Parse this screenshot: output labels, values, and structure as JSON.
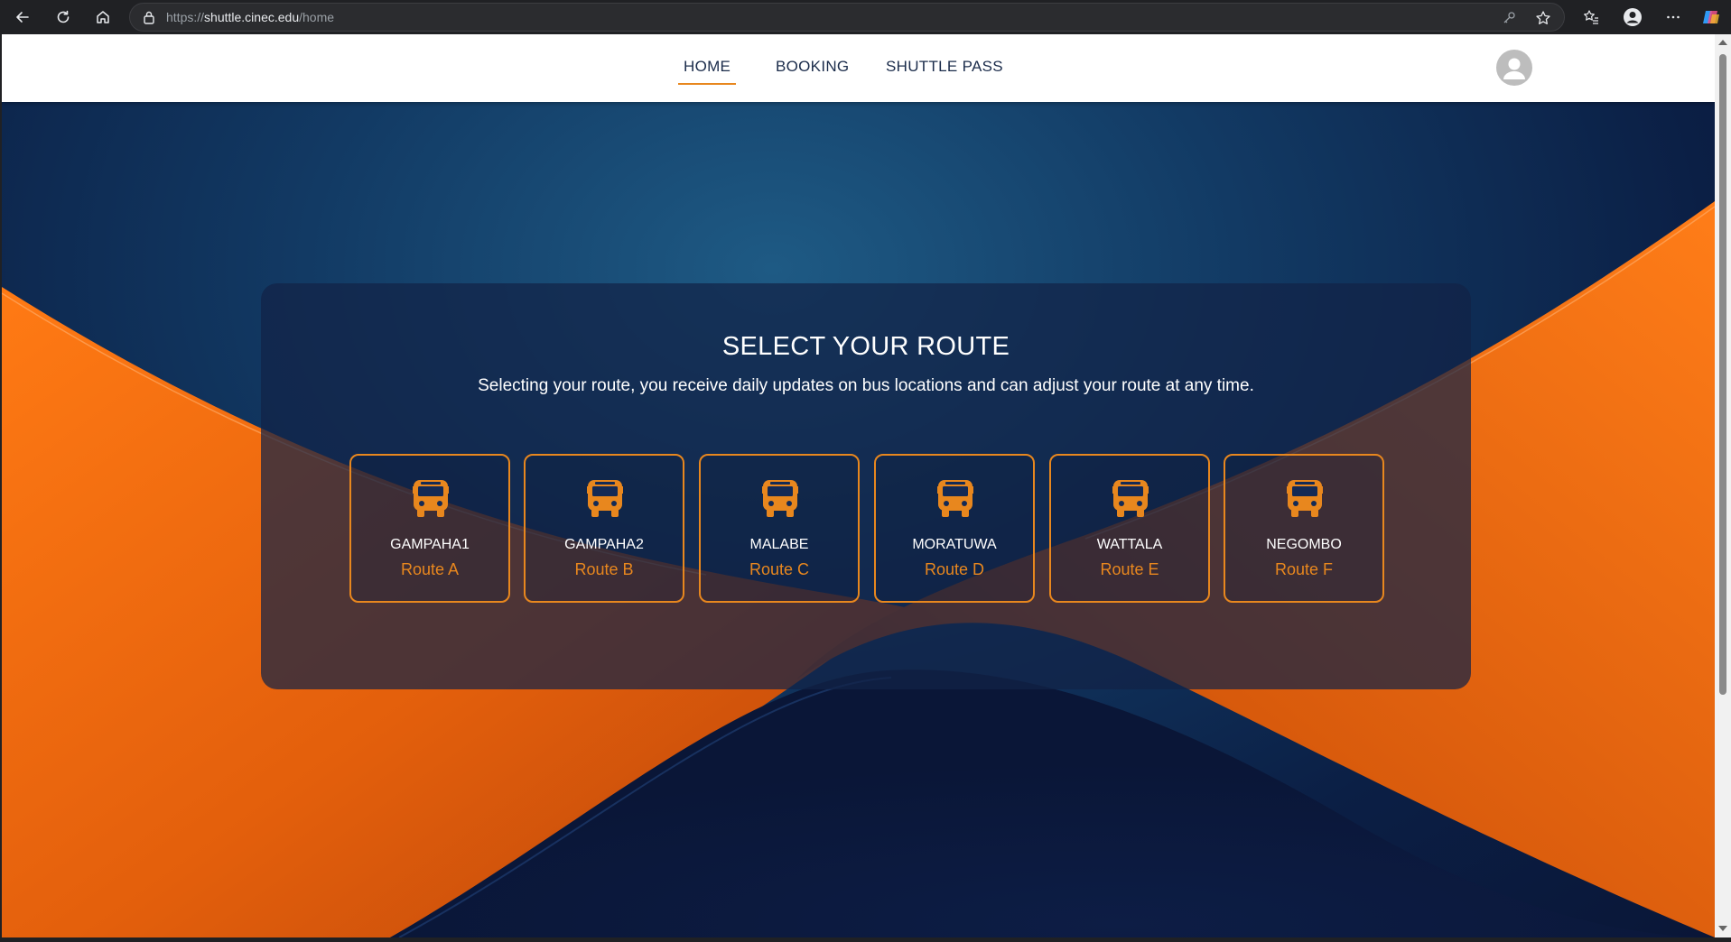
{
  "browser": {
    "url_scheme": "https://",
    "url_host": "shuttle.cinec.edu",
    "url_path": "/home"
  },
  "nav": {
    "tabs": [
      {
        "label": "HOME",
        "active": true
      },
      {
        "label": "BOOKING",
        "active": false
      },
      {
        "label": "SHUTTLE PASS",
        "active": false
      }
    ]
  },
  "hero": {
    "title": "SELECT YOUR ROUTE",
    "description": "Selecting your route, you receive daily updates on bus locations and can adjust your route at any time."
  },
  "routes": [
    {
      "name": "GAMPAHA1",
      "route": "Route A"
    },
    {
      "name": "GAMPAHA2",
      "route": "Route B"
    },
    {
      "name": "MALABE",
      "route": "Route C"
    },
    {
      "name": "MORATUWA",
      "route": "Route D"
    },
    {
      "name": "WATTALA",
      "route": "Route E"
    },
    {
      "name": "NEGOMBO",
      "route": "Route F"
    }
  ],
  "colors": {
    "accent": "#e8871e",
    "header_bg": "#ffffff",
    "nav_text": "#1a2b4a",
    "hero_dark": "#0b1f45",
    "hero_orange": "#ec6a10"
  }
}
